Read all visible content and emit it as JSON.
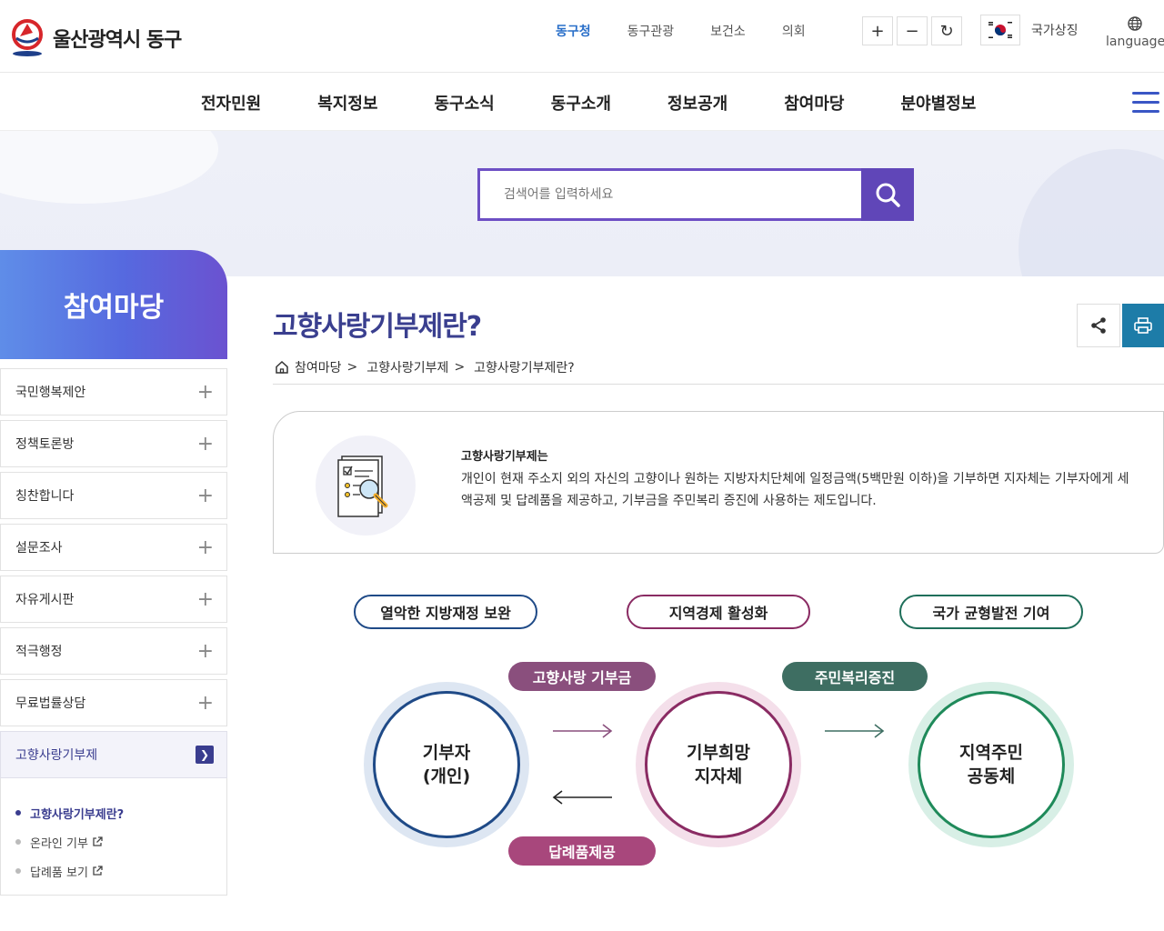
{
  "brand": {
    "name": "울산광역시 동구"
  },
  "top_links": [
    {
      "label": "동구청",
      "active": true
    },
    {
      "label": "동구관광",
      "active": false
    },
    {
      "label": "보건소",
      "active": false
    },
    {
      "label": "의회",
      "active": false
    }
  ],
  "zoom": {
    "in": "+",
    "out": "−",
    "reset": "↻"
  },
  "national_symbol": "국가상징",
  "language": "language",
  "main_nav": [
    "전자민원",
    "복지정보",
    "동구소식",
    "동구소개",
    "정보공개",
    "참여마당",
    "분야별정보"
  ],
  "search": {
    "placeholder": "검색어를 입력하세요"
  },
  "sidebar": {
    "title": "참여마당",
    "items": [
      {
        "label": "국민행복제안"
      },
      {
        "label": "정책토론방"
      },
      {
        "label": "칭찬합니다"
      },
      {
        "label": "설문조사"
      },
      {
        "label": "자유게시판"
      },
      {
        "label": "적극행정"
      },
      {
        "label": "무료법률상담"
      },
      {
        "label": "고향사랑기부제"
      }
    ],
    "sub_items": [
      {
        "label": "고향사랑기부제란?"
      },
      {
        "label": "온라인 기부"
      },
      {
        "label": "답례품 보기"
      }
    ]
  },
  "page": {
    "title": "고향사랑기부제란?",
    "breadcrumb": [
      "참여마당",
      "고향사랑기부제",
      "고향사랑기부제란?"
    ],
    "breadcrumb_sep": ">"
  },
  "intro": {
    "heading": "고향사랑기부제는",
    "text": "개인이 현재 주소지 외의 자신의 고향이나 원하는 지방자치단체에 일정금액(5백만원 이하)을 기부하면 지자체는 기부자에게 세액공제 및 답례품을 제공하고, 기부금을 주민복리 증진에 사용하는 제도입니다."
  },
  "diagram": {
    "goals": [
      "열악한 지방재정 보완",
      "지역경제 활성화",
      "국가 균형발전 기여"
    ],
    "flows": {
      "donation": "고향사랑 기부금",
      "welfare": "주민복리증진",
      "gift": "답례품제공"
    },
    "nodes": [
      {
        "line1": "기부자",
        "line2": "(개인)"
      },
      {
        "line1": "기부희망",
        "line2": "지자체"
      },
      {
        "line1": "지역주민",
        "line2": "공동체"
      }
    ]
  },
  "colors": {
    "primary": "#3a3f8f",
    "accent": "#6046b8",
    "print": "#1d7ca8"
  }
}
